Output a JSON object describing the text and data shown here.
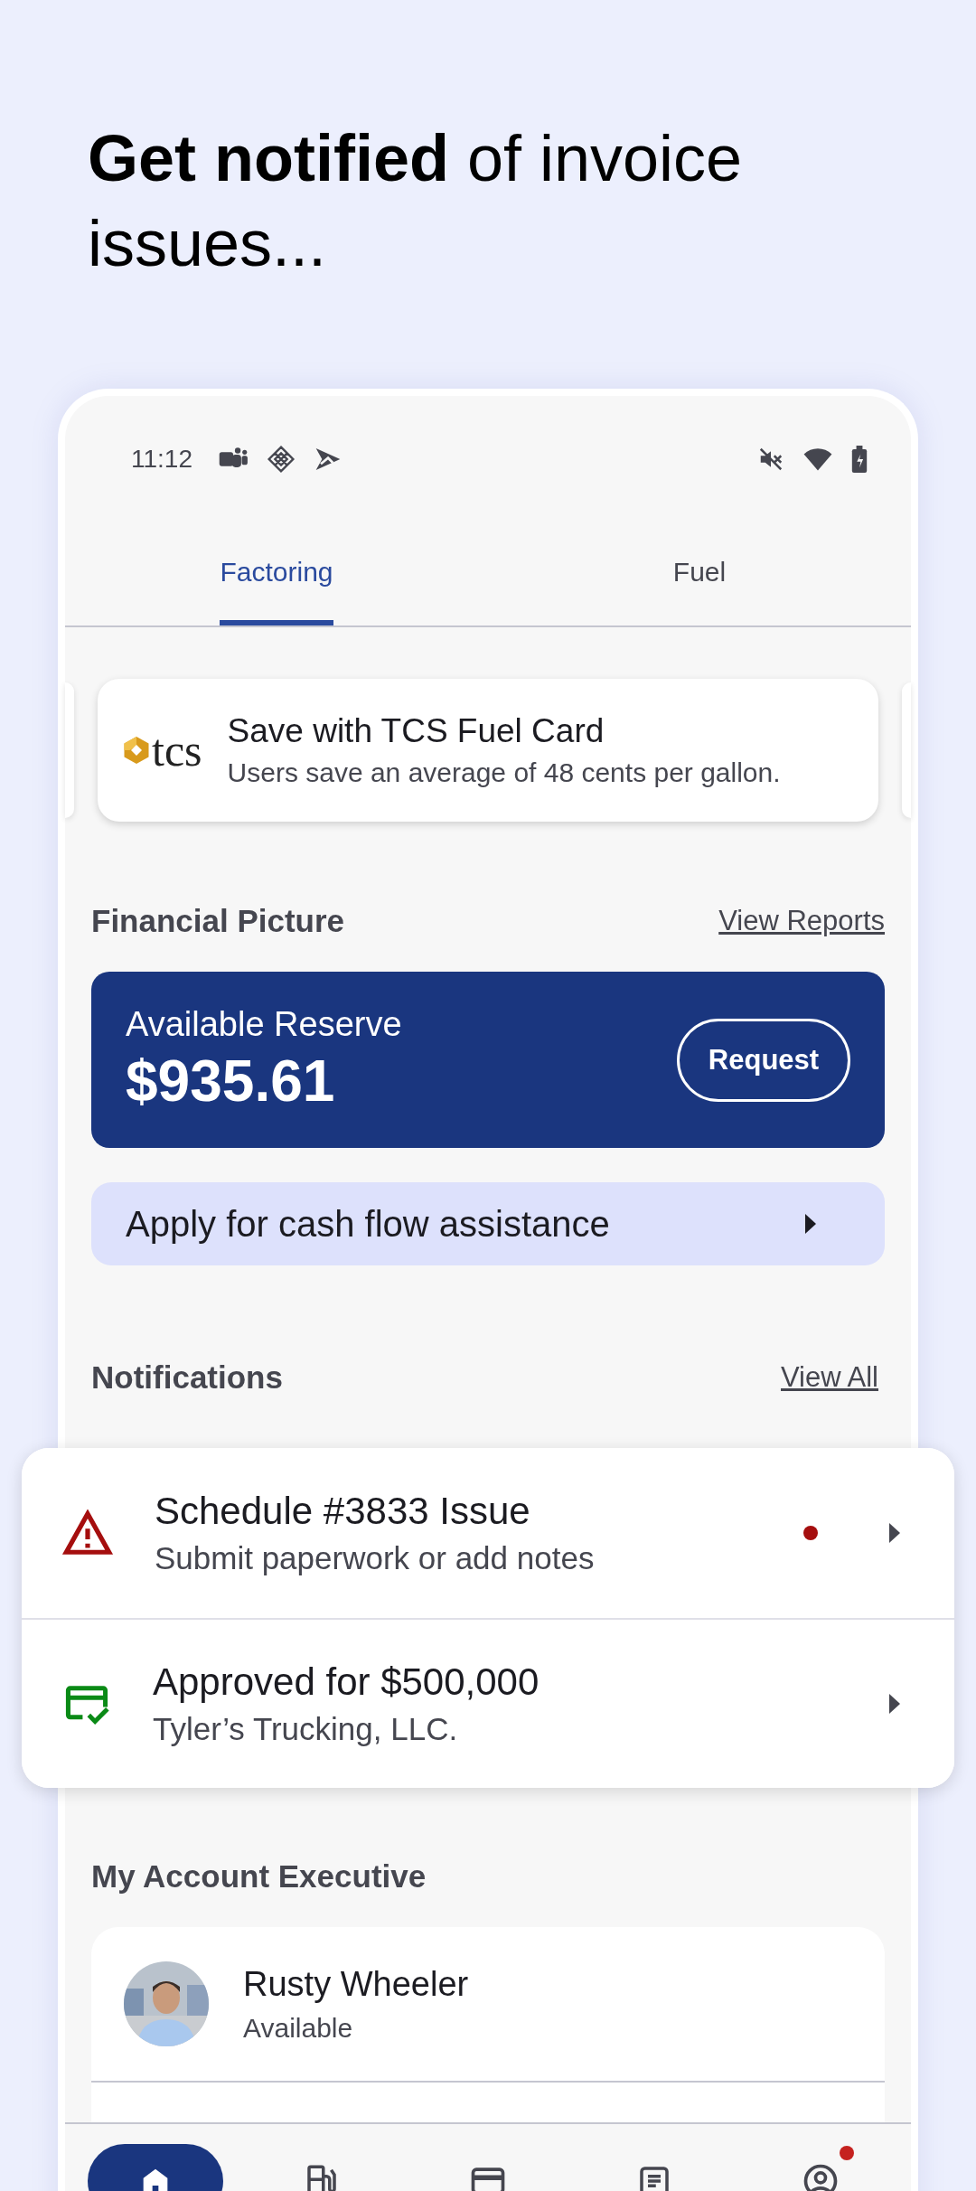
{
  "headline": "**Get notified** of invoice issues...",
  "status_bar": {
    "time": "11:12"
  },
  "tabs": [
    {
      "label": "Factoring",
      "selected": true
    },
    {
      "label": "Fuel",
      "selected": false
    }
  ],
  "promo": {
    "logo_text": "tcs",
    "title": "Save with TCS Fuel Card",
    "subtitle": "Users save an average of 48 cents per gallon."
  },
  "financial": {
    "heading": "Financial Picture",
    "link": "View Reports",
    "reserve_label": "Available Reserve",
    "reserve_amount": "$935.61",
    "request_button": "Request",
    "assist": "Apply for cash flow assistance"
  },
  "notifications": {
    "heading": "Notifications",
    "link": "View All",
    "items": [
      {
        "kind": "warning",
        "title": "Schedule #3833 Issue",
        "subtitle": "Submit paperwork or add notes",
        "unread": true
      },
      {
        "kind": "approved",
        "title": "Approved for $500,000",
        "subtitle": "Tyler’s Trucking, LLC.",
        "unread": false
      }
    ]
  },
  "account_executive": {
    "heading": "My Account Executive",
    "name": "Rusty Wheeler",
    "status": "Available"
  },
  "bottom_nav": [
    {
      "kind": "home",
      "selected": true,
      "badge": false
    },
    {
      "kind": "fuel",
      "selected": false,
      "badge": false
    },
    {
      "kind": "card",
      "selected": false,
      "badge": false
    },
    {
      "kind": "document",
      "selected": false,
      "badge": false
    },
    {
      "kind": "profile",
      "selected": false,
      "badge": true
    }
  ]
}
